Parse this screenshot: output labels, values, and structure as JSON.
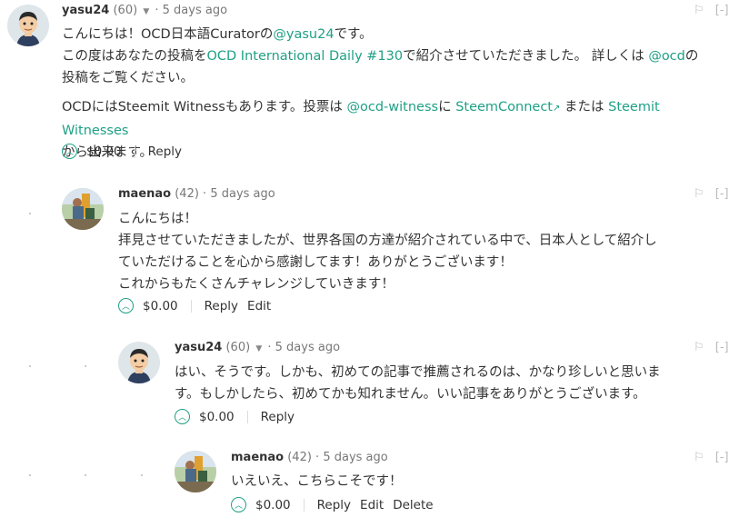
{
  "comments": [
    {
      "author": "yasu24",
      "reputation": "(60)",
      "time": "5 days ago",
      "flag_icon": "flag-icon",
      "collapse": "[-]",
      "paragraph1_lines": [
        [
          "こんにちは！OCD日本語Curatorの",
          "@yasu24",
          "です。"
        ],
        [
          "この度はあなたの投稿を",
          "OCD International Daily #130",
          "で紹介させていただきました。 詳しくは ",
          "@ocd",
          "の"
        ],
        [
          "投稿をご覧ください。"
        ]
      ],
      "paragraph2_lines": [
        [
          "OCDにはSteemit Witnessもあります。投票は ",
          "@ocd-witness",
          "に ",
          "SteemConnect",
          " または ",
          "Steemit Witnesses"
        ],
        [
          "から出来ます。"
        ]
      ],
      "payout": "$0.00",
      "actions": [
        "Reply"
      ]
    },
    {
      "author": "maenao",
      "reputation": "(42)",
      "time": "5 days ago",
      "collapse": "[-]",
      "lines": [
        "こんにちは！",
        "拝見させていただきましたが、世界各国の方達が紹介されている中で、日本人として紹介し",
        "ていただけることを心から感謝してます！ありがとうございます！",
        "これからもたくさんチャレンジしていきます！"
      ],
      "payout": "$0.00",
      "actions": [
        "Reply",
        "Edit"
      ]
    },
    {
      "author": "yasu24",
      "reputation": "(60)",
      "time": "5 days ago",
      "collapse": "[-]",
      "lines": [
        "はい、そうです。しかも、初めての記事で推薦されるのは、かなり珍しいと思いま",
        "す。もしかしたら、初めてかも知れません。いい記事をありがとうございます。"
      ],
      "payout": "$0.00",
      "actions": [
        "Reply"
      ]
    },
    {
      "author": "maenao",
      "reputation": "(42)",
      "time": "5 days ago",
      "collapse": "[-]",
      "lines": [
        "いえいえ、こちらこそです！"
      ],
      "payout": "$0.00",
      "actions": [
        "Reply",
        "Edit",
        "Delete"
      ]
    }
  ],
  "colors": {
    "link": "#1fa086",
    "muted": "#777777"
  }
}
